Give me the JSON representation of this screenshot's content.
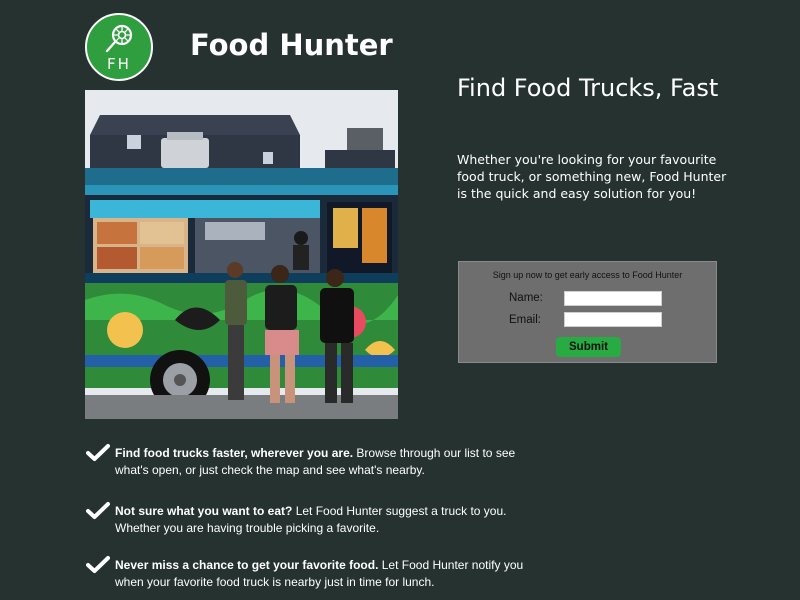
{
  "logo": {
    "initials": "FH"
  },
  "brand": {
    "name": "Food Hunter"
  },
  "hero": {
    "headline": "Find Food Trucks, Fast",
    "intro": "Whether you're looking for your favourite food truck, or something new, Food Hunter is the quick and easy solution  for you!"
  },
  "signup": {
    "title": "Sign up now to get early access to Food Hunter",
    "name_label": "Name:",
    "email_label": "Email:",
    "name_value": "",
    "email_value": "",
    "submit_label": "Submit"
  },
  "features": [
    {
      "bold": "Find food trucks faster, wherever you are.",
      "text": " Browse through our list to see what's open, or just check the map and see what's nearby."
    },
    {
      "bold": "Not sure what you want to eat?",
      "text": " Let Food Hunter suggest a truck to you. Whether you are having trouble picking a favorite."
    },
    {
      "bold": "Never miss a chance to get your favorite food.",
      "text": " Let Food Hunter notify you when your favorite food truck is nearby just in time for lunch."
    }
  ],
  "colors": {
    "background": "#263230",
    "brand_green": "#2e9e3e",
    "button_green": "#27ab42",
    "form_panel": "#6e6e6e"
  },
  "icons": [
    "lollipop-logo-icon",
    "check-icon"
  ]
}
